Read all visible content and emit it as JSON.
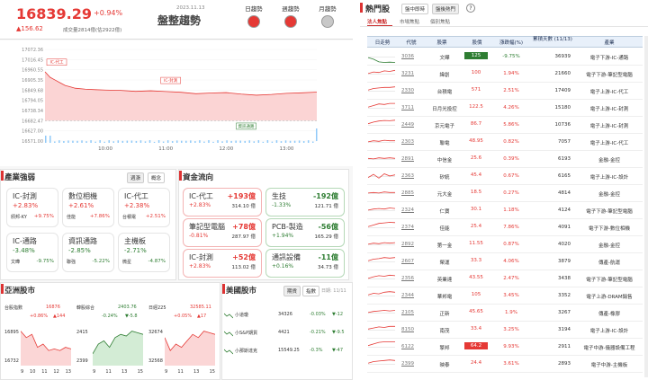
{
  "header": {
    "index_value": "16839.29",
    "index_pct": "+0.94%",
    "index_change": "▲156.62",
    "volume_text": "成交量2814億(估2922億)",
    "date": "2023.11.13",
    "title": "盤整趨勢",
    "trend_labels": [
      "日趨勢",
      "週趨勢",
      "月趨勢"
    ],
    "trend_colors": [
      "#e53935",
      "#e53935",
      "#c8c8c8"
    ]
  },
  "chart_data": {
    "type": "area",
    "y_ticks": [
      "17072.36",
      "17016.45",
      "16960.55",
      "16905.35",
      "16849.68",
      "16794.05",
      "16738.34",
      "16682.47",
      "16627.00",
      "16571.00"
    ],
    "x_ticks": [
      "10:00",
      "11:00",
      "12:00",
      "13:00"
    ],
    "labels": [
      "IC-代工",
      "IC-封測",
      "資訊通路"
    ],
    "ylim": [
      16571,
      17072.36
    ],
    "prev_close": 16682.67,
    "x": [
      "09:00",
      "09:05",
      "09:10",
      "09:15",
      "09:20",
      "09:25",
      "09:30",
      "09:40",
      "09:50",
      "10:00",
      "10:15",
      "10:30",
      "10:45",
      "11:00",
      "11:15",
      "11:30",
      "11:45",
      "12:00",
      "12:15",
      "12:30",
      "12:45",
      "13:00",
      "13:15",
      "13:30"
    ],
    "values": [
      16950,
      16920,
      16905,
      16890,
      16875,
      16868,
      16860,
      16855,
      16852,
      16850,
      16848,
      16843,
      16846,
      16842,
      16838,
      16830,
      16834,
      16836,
      16828,
      16822,
      16826,
      16832,
      16835,
      16839
    ]
  },
  "industry": {
    "title": "產業強弱",
    "toggles": [
      "週漲",
      "概念"
    ],
    "cards": [
      {
        "name": "IC-封測",
        "pct": "+2.83%",
        "sub_name": "頎邦-KY",
        "sub_pct": "+9.75%",
        "color": "#e53935"
      },
      {
        "name": "數位相機",
        "pct": "+2.61%",
        "sub_name": "佳能",
        "sub_pct": "+7.86%",
        "color": "#e53935"
      },
      {
        "name": "IC-代工",
        "pct": "+2.38%",
        "sub_name": "台積電",
        "sub_pct": "+2.51%",
        "color": "#e53935"
      },
      {
        "name": "IC-通路",
        "pct": "-3.48%",
        "sub_name": "文曄",
        "sub_pct": "-9.75%",
        "color": "#2e7d32"
      },
      {
        "name": "資訊通路",
        "pct": "-2.85%",
        "sub_name": "聯強",
        "sub_pct": "-5.22%",
        "color": "#2e7d32"
      },
      {
        "name": "主機板",
        "pct": "-2.71%",
        "sub_name": "微星",
        "sub_pct": "-4.87%",
        "color": "#2e7d32"
      }
    ]
  },
  "fundflow": {
    "title": "資金流向",
    "cards": [
      {
        "name": "IC-代工",
        "pct": "+2.83%",
        "amt": "+193億",
        "amt2": "314.10 億",
        "color": "#e53935"
      },
      {
        "name": "生技",
        "pct": "-1.33%",
        "amt": "-192億",
        "amt2": "121.71 億",
        "color": "#2e7d32"
      },
      {
        "name": "筆記型電腦",
        "pct": "-0.81%",
        "amt": "+78億",
        "amt2": "287.97 億",
        "color": "#e53935"
      },
      {
        "name": "PCB-製造",
        "pct": "+1.94%",
        "amt": "-56億",
        "amt2": "165.29 億",
        "color": "#2e7d32"
      },
      {
        "name": "IC-封測",
        "pct": "+2.83%",
        "amt": "+52億",
        "amt2": "113.02 億",
        "color": "#e53935"
      },
      {
        "name": "通訊設備",
        "pct": "+0.16%",
        "amt": "-11億",
        "amt2": "34.73 億",
        "color": "#2e7d32"
      }
    ]
  },
  "asia": {
    "title": "亞洲股市",
    "markets": [
      {
        "name": "台股指數",
        "value": "16876",
        "pct": "+0.86%",
        "chg": "▲144",
        "hi": "16895",
        "lo": "16732",
        "color": "#e53935",
        "ticks": [
          "9",
          "10",
          "11",
          "12",
          "13"
        ]
      },
      {
        "name": "韓股綜合",
        "value": "2403.76",
        "pct": "-0.24%",
        "chg": "▼-5.8",
        "hi": "2415",
        "lo": "2399",
        "color": "#2e7d32",
        "ticks": [
          "9",
          "11",
          "13",
          "15"
        ]
      },
      {
        "name": "日經225",
        "value": "32585.11",
        "pct": "+0.05%",
        "chg": "▲17",
        "hi": "32674",
        "lo": "32568",
        "color": "#e53935",
        "ticks": [
          "9",
          "11",
          "13",
          "15"
        ]
      }
    ]
  },
  "us": {
    "title": "美國股市",
    "toggles": [
      "期貨",
      "指數"
    ],
    "date": "日期: 11/11",
    "rows": [
      {
        "name": "小道瓊",
        "value": "34326",
        "pct": "-0.03%",
        "chg": "▼-12",
        "color": "#2e7d32"
      },
      {
        "name": "小S&P期貨",
        "value": "4421",
        "pct": "-0.21%",
        "chg": "▼-9.5",
        "color": "#2e7d32"
      },
      {
        "name": "小那斯達克",
        "value": "15549.25",
        "pct": "-0.3%",
        "chg": "▼-47",
        "color": "#2e7d32"
      }
    ]
  },
  "hot": {
    "title": "熱門股",
    "tabs": [
      "盤中即時",
      "盤後熱門"
    ],
    "help": "?",
    "subtabs": [
      "法人焦點",
      "市場焦點",
      "個別焦點"
    ],
    "columns": [
      "日走勢",
      "代號",
      "股票",
      "股價",
      "漲跌幅(%)",
      "累積天數 (11/13)",
      "產業"
    ],
    "rows": [
      {
        "code": "3036",
        "name": "文曄",
        "price": "125",
        "pct": "-9.75%",
        "days": "36939",
        "ind": "電子下游-IC-通路",
        "pc": "#2e7d32",
        "hl": "#2e7d32",
        "trend": [
          -0.1,
          -0.4,
          -0.9,
          -1,
          -0.95,
          -1
        ]
      },
      {
        "code": "3231",
        "name": "緯創",
        "price": "100",
        "pct": "1.94%",
        "days": "21660",
        "ind": "電子下游-筆記型電腦",
        "pc": "#e53935",
        "hl": "",
        "trend": [
          0.1,
          0.4,
          0.3,
          0.6,
          0.5,
          0.7
        ]
      },
      {
        "code": "2330",
        "name": "台積電",
        "price": "571",
        "pct": "2.51%",
        "days": "17409",
        "ind": "電子上游-IC-代工",
        "pc": "#e53935",
        "hl": "",
        "trend": [
          0.2,
          0.5,
          0.6,
          0.7,
          0.7,
          0.8
        ]
      },
      {
        "code": "3711",
        "name": "日月光投控",
        "price": "122.5",
        "pct": "4.26%",
        "days": "15180",
        "ind": "電子上游-IC-封測",
        "pc": "#e53935",
        "hl": "",
        "trend": [
          0.2,
          0.5,
          0.8,
          0.7,
          0.9,
          0.9
        ]
      },
      {
        "code": "2449",
        "name": "京元電子",
        "price": "86.7",
        "pct": "5.86%",
        "days": "10736",
        "ind": "電子上游-IC-封測",
        "pc": "#e53935",
        "hl": "",
        "trend": [
          0.3,
          0.6,
          0.8,
          0.9,
          0.85,
          0.95
        ]
      },
      {
        "code": "2303",
        "name": "聯電",
        "price": "48.95",
        "pct": "0.82%",
        "days": "7057",
        "ind": "電子上游-IC-代工",
        "pc": "#e53935",
        "hl": "",
        "trend": [
          0.1,
          0.3,
          0.2,
          0.4,
          0.3,
          0.3
        ]
      },
      {
        "code": "2891",
        "name": "中信金",
        "price": "25.6",
        "pct": "0.39%",
        "days": "6193",
        "ind": "金融-金控",
        "pc": "#e53935",
        "hl": "",
        "trend": [
          0.2,
          0.1,
          0.3,
          0.2,
          0.3,
          0.2
        ]
      },
      {
        "code": "2363",
        "name": "矽統",
        "price": "45.4",
        "pct": "0.67%",
        "days": "6165",
        "ind": "電子上游-IC-設計",
        "pc": "#e53935",
        "hl": "",
        "trend": [
          -0.2,
          0.4,
          -0.3,
          0.5,
          0.1,
          0.3
        ]
      },
      {
        "code": "2885",
        "name": "元大金",
        "price": "18.5",
        "pct": "0.27%",
        "days": "4814",
        "ind": "金融-金控",
        "pc": "#e53935",
        "hl": "",
        "trend": [
          0.1,
          0.2,
          0.1,
          0.3,
          0.2,
          0.2
        ]
      },
      {
        "code": "2324",
        "name": "仁寶",
        "price": "30.1",
        "pct": "1.18%",
        "days": "4124",
        "ind": "電子下游-筆記型電腦",
        "pc": "#e53935",
        "hl": "",
        "trend": [
          0.1,
          0.3,
          0.4,
          0.3,
          0.5,
          0.4
        ]
      },
      {
        "code": "2374",
        "name": "佳能",
        "price": "25.4",
        "pct": "7.86%",
        "days": "4091",
        "ind": "電子下游-數位相機",
        "pc": "#e53935",
        "hl": "",
        "trend": [
          0.2,
          0.5,
          0.8,
          0.9,
          1,
          0.95
        ]
      },
      {
        "code": "2892",
        "name": "第一金",
        "price": "11.55",
        "pct": "0.87%",
        "days": "4020",
        "ind": "金融-金控",
        "pc": "#e53935",
        "hl": "",
        "trend": [
          0.1,
          0.3,
          0.2,
          0.4,
          0.3,
          0.4
        ]
      },
      {
        "code": "2607",
        "name": "榮運",
        "price": "33.3",
        "pct": "4.06%",
        "days": "3879",
        "ind": "傳產-航運",
        "pc": "#e53935",
        "hl": "",
        "trend": [
          0.2,
          0.5,
          0.6,
          0.8,
          0.7,
          0.8
        ]
      },
      {
        "code": "2356",
        "name": "英業達",
        "price": "43.55",
        "pct": "2.47%",
        "days": "3438",
        "ind": "電子下游-筆記型電腦",
        "pc": "#e53935",
        "hl": "",
        "trend": [
          0.1,
          0.4,
          0.6,
          0.5,
          0.7,
          0.6
        ]
      },
      {
        "code": "2344",
        "name": "華邦電",
        "price": "105",
        "pct": "3.45%",
        "days": "3352",
        "ind": "電子上游-DRAM銷售",
        "pc": "#e53935",
        "hl": "",
        "trend": [
          0.2,
          0.5,
          0.4,
          0.7,
          0.8,
          0.7
        ]
      },
      {
        "code": "2105",
        "name": "正新",
        "price": "45.65",
        "pct": "1.9%",
        "days": "3267",
        "ind": "傳產-橡膠",
        "pc": "#e53935",
        "hl": "",
        "trend": [
          0.1,
          0.3,
          0.4,
          0.5,
          0.4,
          0.5
        ]
      },
      {
        "code": "8150",
        "name": "南茂",
        "price": "33.4",
        "pct": "3.25%",
        "days": "3194",
        "ind": "電子上游-IC-設計",
        "pc": "#e53935",
        "hl": "",
        "trend": [
          0.2,
          0.4,
          0.6,
          0.5,
          0.7,
          0.7
        ]
      },
      {
        "code": "6122",
        "name": "擎邦",
        "price": "64.2",
        "pct": "9.93%",
        "days": "2911",
        "ind": "電子中游-儀器設備工程",
        "pc": "#e53935",
        "hl": "#e53935",
        "trend": [
          0.3,
          0.6,
          0.9,
          1,
          1,
          1
        ]
      },
      {
        "code": "2399",
        "name": "映泰",
        "price": "24.4",
        "pct": "3.61%",
        "days": "2893",
        "ind": "電子中游-主機板",
        "pc": "#e53935",
        "hl": "",
        "trend": [
          0.2,
          0.5,
          0.6,
          0.7,
          0.8,
          0.7
        ]
      }
    ]
  }
}
